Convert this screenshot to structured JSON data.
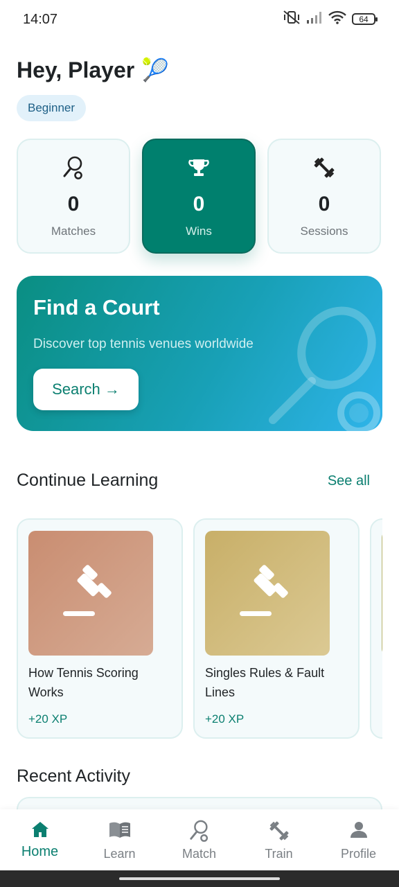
{
  "status_bar": {
    "time": "14:07",
    "battery": "64"
  },
  "greeting": {
    "text": "Hey, Player",
    "emoji": "🎾"
  },
  "level_badge": "Beginner",
  "stats": [
    {
      "icon": "racket-icon",
      "value": "0",
      "label": "Matches"
    },
    {
      "icon": "trophy-icon",
      "value": "0",
      "label": "Wins"
    },
    {
      "icon": "dumbbell-icon",
      "value": "0",
      "label": "Sessions"
    }
  ],
  "banner": {
    "title": "Find a Court",
    "subtitle": "Discover top tennis venues worldwide",
    "button_label": "Search →"
  },
  "continue_learning": {
    "title": "Continue Learning",
    "see_all": "See all",
    "cards": [
      {
        "title": "How Tennis Scoring Works",
        "xp": "+20 XP",
        "color": "#c98d71"
      },
      {
        "title": "Singles Rules & Fault Lines",
        "xp": "+20 XP",
        "color": "#c8af68"
      }
    ]
  },
  "recent_activity": {
    "title": "Recent Activity"
  },
  "bottom_nav": {
    "items": [
      {
        "label": "Home",
        "icon": "home-icon"
      },
      {
        "label": "Learn",
        "icon": "book-icon"
      },
      {
        "label": "Match",
        "icon": "racket-icon"
      },
      {
        "label": "Train",
        "icon": "dumbbell-icon"
      },
      {
        "label": "Profile",
        "icon": "profile-icon"
      }
    ]
  },
  "colors": {
    "accent": "#00806e",
    "accent_text": "#0b7f70",
    "badge_bg": "#e2f1fa"
  }
}
